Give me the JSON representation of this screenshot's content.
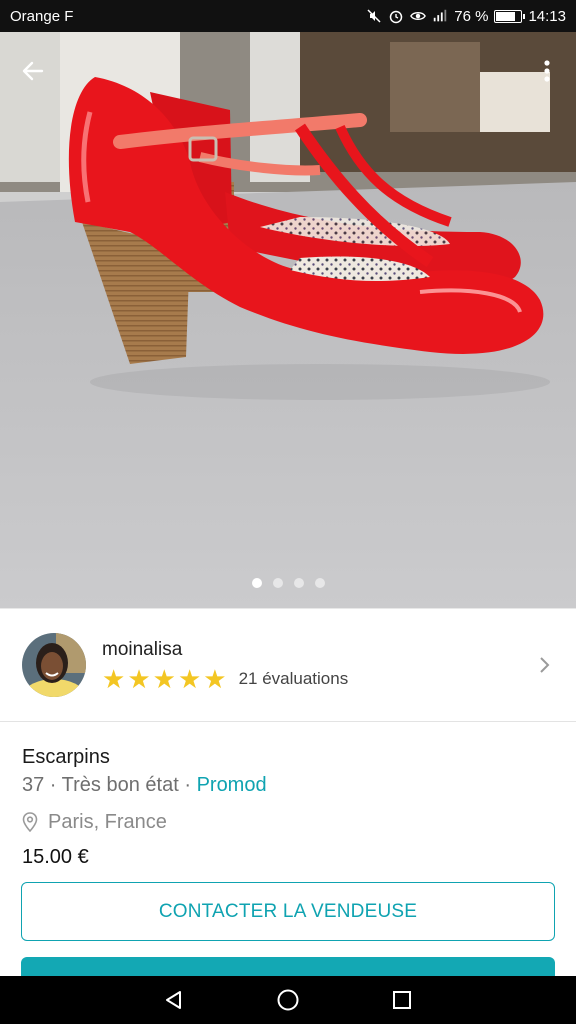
{
  "status_bar": {
    "carrier": "Orange F",
    "battery_percent": "76 %",
    "battery_level": 0.76,
    "time": "14:13",
    "icons": [
      "mute-icon",
      "alarm-icon",
      "eye-icon",
      "signal-icon",
      "battery-icon"
    ]
  },
  "photo": {
    "description_icon": "red-patent-heels-photo",
    "image_count": 4,
    "active_index": 0
  },
  "seller": {
    "name": "moinalisa",
    "rating": 5,
    "rating_count": "21 évaluations"
  },
  "item": {
    "title": "Escarpins",
    "size": "37",
    "separator": " · ",
    "condition": "Très bon état",
    "brand": "Promod",
    "location": "Paris, France",
    "price": "15.00 €"
  },
  "actions": {
    "contact_label": "CONTACTER LA VENDEUSE"
  },
  "colors": {
    "accent": "#0fa3b1",
    "star": "#f3c623",
    "shoe": "#e8151c"
  }
}
